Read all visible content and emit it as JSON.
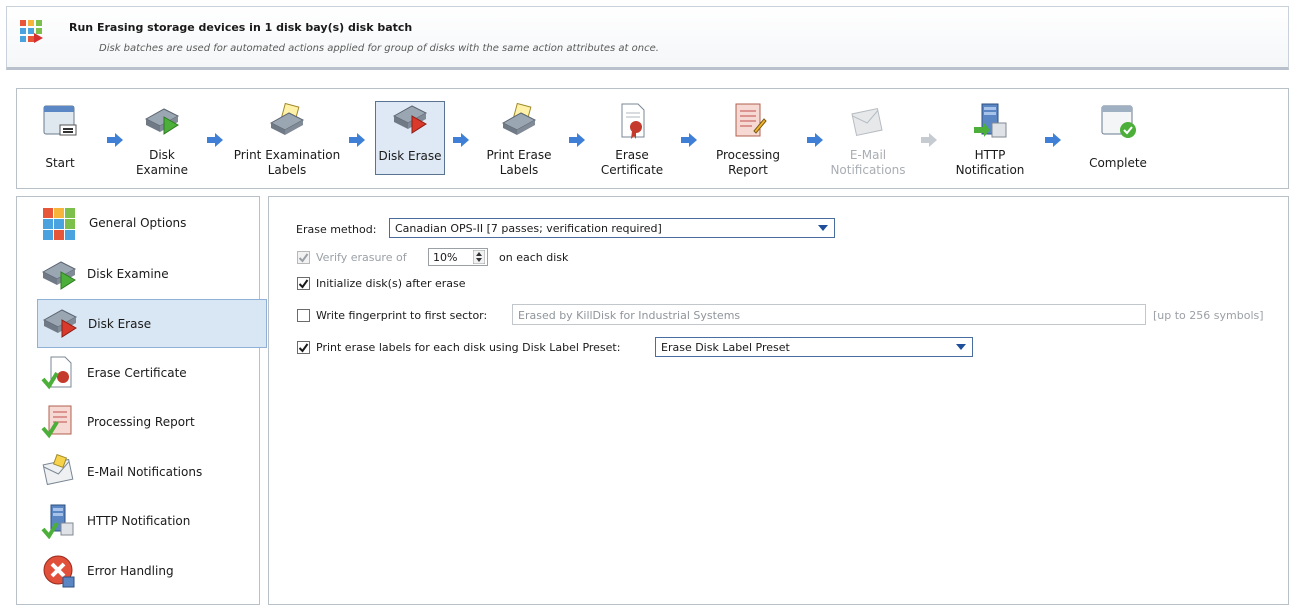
{
  "header": {
    "title": "Run Erasing storage devices in 1 disk bay(s) disk batch",
    "subtitle": "Disk batches are used for automated actions applied for group of disks with the same action attributes at once."
  },
  "wizard": {
    "steps": [
      {
        "label": "Start"
      },
      {
        "label": "Disk\nExamine"
      },
      {
        "label": "Print Examination\nLabels"
      },
      {
        "label": "Disk Erase"
      },
      {
        "label": "Print Erase\nLabels"
      },
      {
        "label": "Erase\nCertificate"
      },
      {
        "label": "Processing\nReport"
      },
      {
        "label": "E-Mail\nNotifications"
      },
      {
        "label": "HTTP\nNotification"
      },
      {
        "label": "Complete"
      }
    ]
  },
  "sidebar": {
    "items": [
      {
        "label": "General Options"
      },
      {
        "label": "Disk Examine"
      },
      {
        "label": "Disk Erase"
      },
      {
        "label": "Erase Certificate"
      },
      {
        "label": "Processing Report"
      },
      {
        "label": "E-Mail Notifications"
      },
      {
        "label": "HTTP Notification"
      },
      {
        "label": "Error Handling"
      }
    ]
  },
  "main": {
    "erase_method_label": "Erase method:",
    "erase_method_value": "Canadian OPS-II [7 passes; verification required]",
    "verify_label": "Verify erasure of",
    "verify_value": "10%",
    "verify_suffix": "on each disk",
    "initialize_label": "Initialize disk(s) after erase",
    "fingerprint_label": "Write fingerprint to first sector:",
    "fingerprint_value": "Erased by KillDisk for Industrial Systems",
    "fingerprint_hint": "[up to 256 symbols]",
    "print_labels_label": "Print erase labels for each disk using Disk Label Preset:",
    "print_labels_preset": "Erase Disk Label Preset"
  },
  "colors": {
    "accent": "#4a6da0",
    "active_bg": "#dfe9f5",
    "arrow_blue": "#3f7fd6",
    "disabled_text": "#a9aeb4"
  }
}
